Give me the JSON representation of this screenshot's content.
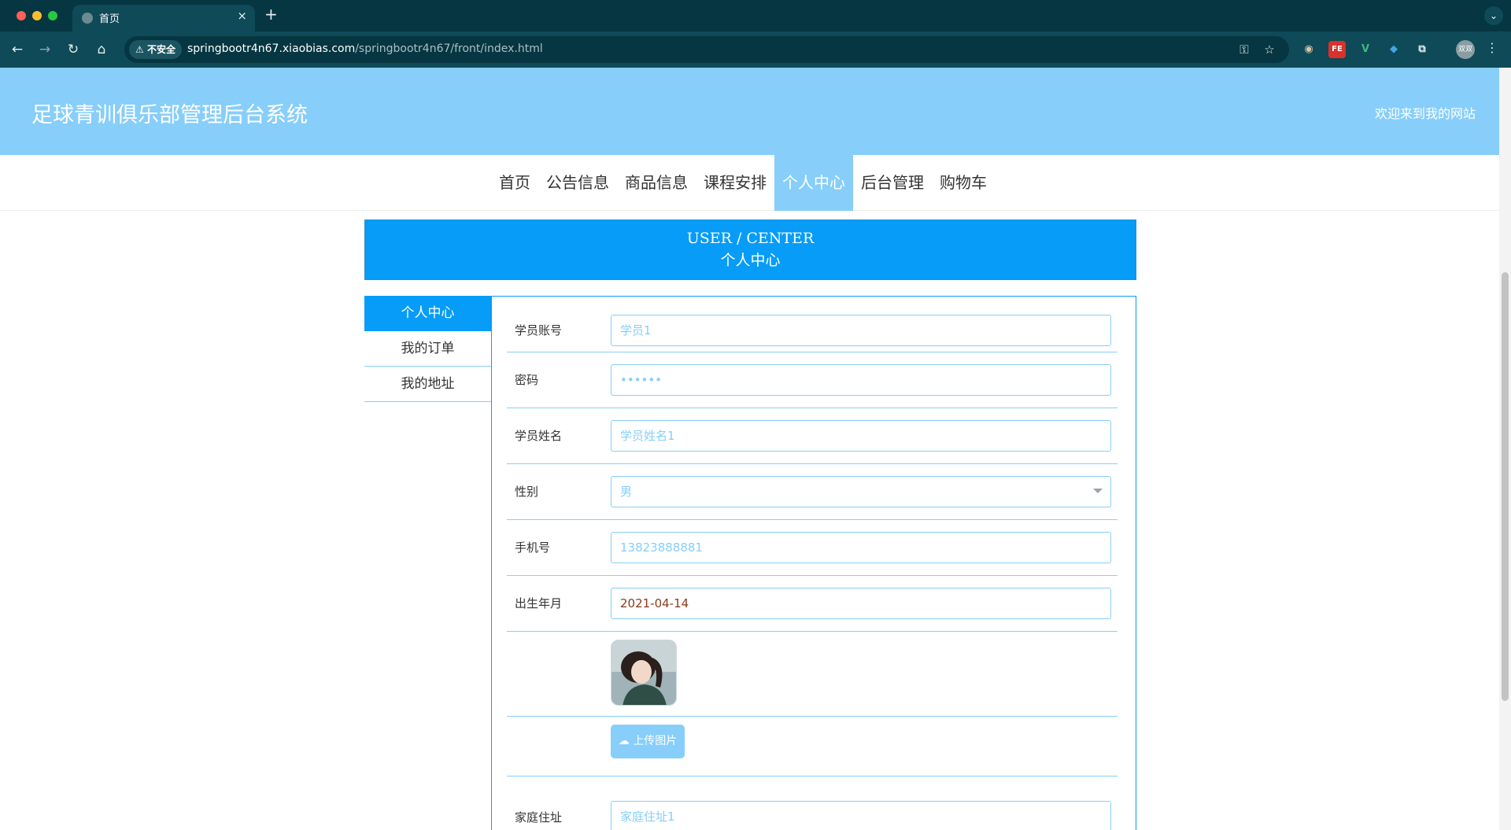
{
  "browser": {
    "tab_title": "首页",
    "tab_close": "×",
    "new_tab": "+",
    "security_label": "不安全",
    "url_host": "springbootr4n67.xiaobias.com",
    "url_path": "/springbootr4n67/front/index.html",
    "profile_initials": "双双",
    "ext_fe_label": "FE",
    "ext_v_label": "V"
  },
  "header": {
    "site_title": "足球青训俱乐部管理后台系统",
    "welcome": "欢迎来到我的网站"
  },
  "nav": {
    "items": [
      "首页",
      "公告信息",
      "商品信息",
      "课程安排",
      "个人中心",
      "后台管理",
      "购物车"
    ],
    "active_index": 4
  },
  "banner": {
    "en": "USER / CENTER",
    "cn": "个人中心"
  },
  "side_menu": {
    "items": [
      "个人中心",
      "我的订单",
      "我的地址"
    ],
    "active_index": 0
  },
  "form": {
    "account_label": "学员账号",
    "account_value": "学员1",
    "password_label": "密码",
    "password_value": "••••••",
    "name_label": "学员姓名",
    "name_value": "学员姓名1",
    "gender_label": "性别",
    "gender_value": "男",
    "phone_label": "手机号",
    "phone_value": "13823888881",
    "birth_label": "出生年月",
    "birth_value": "2021-04-14",
    "upload_label": "上传图片",
    "address_label": "家庭住址",
    "address_value": "家庭住址1"
  },
  "colors": {
    "header_bg": "#87cefa",
    "accent": "#069cf7",
    "chrome_dark": "#053641",
    "chrome_toolbar": "#0e4a57"
  }
}
